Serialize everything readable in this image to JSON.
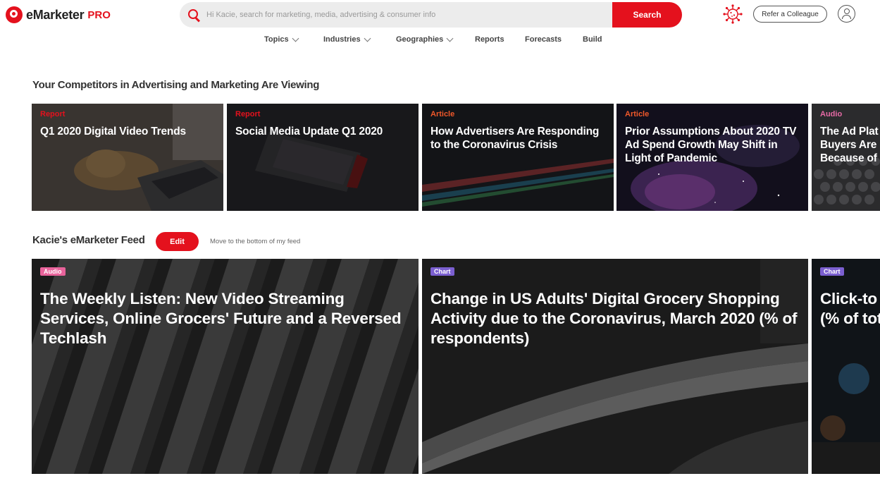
{
  "brand": {
    "name": "eMarketer",
    "tier": "PRO"
  },
  "search": {
    "placeholder": "Hi Kacie, search for marketing, media, advertising & consumer info",
    "button_label": "Search"
  },
  "header": {
    "refer_label": "Refer a Colleague"
  },
  "nav": {
    "items": [
      {
        "label": "Topics",
        "has_dropdown": true
      },
      {
        "label": "Industries",
        "has_dropdown": true
      },
      {
        "label": "Geographies",
        "has_dropdown": true
      },
      {
        "label": "Reports",
        "has_dropdown": false
      },
      {
        "label": "Forecasts",
        "has_dropdown": false
      },
      {
        "label": "Build",
        "has_dropdown": false
      }
    ]
  },
  "competitors": {
    "heading": "Your Competitors in Advertising and Marketing Are Viewing",
    "cards": [
      {
        "type": "Report",
        "title": "Q1 2020 Digital Video Trends",
        "type_color": "#e4111d"
      },
      {
        "type": "Report",
        "title": "Social Media Update Q1 2020",
        "type_color": "#e4111d"
      },
      {
        "type": "Article",
        "title": "How Advertisers Are Responding to the Coronavirus Crisis",
        "type_color": "#f0582a"
      },
      {
        "type": "Article",
        "title": "Prior Assumptions About 2020 TV Ad Spend Growth May Shift in Light of Pandemic",
        "type_color": "#f0582a"
      },
      {
        "type": "Audio",
        "title": "The Ad Plat Buyers Are U Because of",
        "type_color": "#e86aa6"
      }
    ]
  },
  "feed": {
    "heading": "Kacie's eMarketer Feed",
    "edit_label": "Edit",
    "move_label": "Move to the bottom of my feed",
    "cards": [
      {
        "badge": "Audio",
        "badge_color": "#e8639b",
        "title": "The Weekly Listen: New Video Streaming Services, Online Grocers' Future and a Reversed Techlash"
      },
      {
        "badge": "Chart",
        "badge_color": "#7b5fd0",
        "title": "Change in US Adults' Digital Grocery Shopping Activity due to the Coronavirus, March 2020 (% of respondents)"
      },
      {
        "badge": "Chart",
        "badge_color": "#7b5fd0",
        "title": "Click-to Made or (% of tot"
      }
    ]
  },
  "colors": {
    "accent": "#e4111d"
  }
}
